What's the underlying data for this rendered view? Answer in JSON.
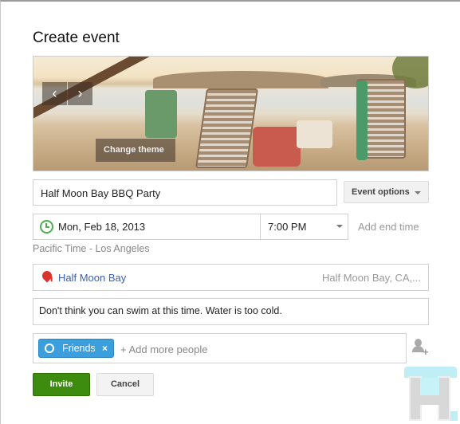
{
  "dialog": {
    "title": "Create event"
  },
  "banner": {
    "prev_icon": "chevron-left-icon",
    "next_icon": "chevron-right-icon",
    "prev_label": "‹",
    "next_label": "›",
    "change_theme_label": "Change theme"
  },
  "event": {
    "name_value": "Half Moon Bay BBQ Party",
    "options_label": "Event options",
    "date_value": "Mon, Feb 18, 2013",
    "time_value": "7:00 PM",
    "add_end_time_label": "Add end time",
    "timezone_label": "Pacific Time - Los Angeles",
    "location_value": "Half Moon Bay",
    "location_hint": "Half Moon Bay, CA,...",
    "description_value": "Don't think you can swim at this time.  Water is too cold."
  },
  "guests": {
    "chips": [
      {
        "label": "Friends",
        "remove_label": "×"
      }
    ],
    "add_more_placeholder": "+ Add more people",
    "add_person_plus": "+"
  },
  "actions": {
    "invite_label": "Invite",
    "cancel_label": "Cancel"
  },
  "colors": {
    "invite_green": "#3d8b0f",
    "chip_blue": "#3b9fdd",
    "clock_green": "#4cae4c",
    "pin_red": "#d9342b",
    "location_blue": "#3d5fae"
  }
}
